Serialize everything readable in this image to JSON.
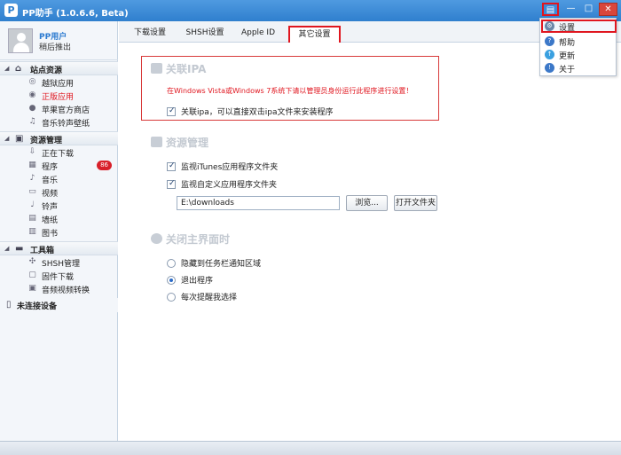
{
  "window": {
    "title": "PP助手 (1.0.6.6, Beta)",
    "logo_letter": "P"
  },
  "user": {
    "name": "PP用户",
    "status": "稍后推出"
  },
  "sidebar": {
    "groups": [
      {
        "label": "站点资源",
        "items": [
          "越狱应用",
          "正版应用",
          "苹果官方商店",
          "音乐铃声壁纸"
        ]
      },
      {
        "label": "资源管理",
        "items": [
          "正在下载",
          "程序",
          "音乐",
          "视频",
          "铃声",
          "墙纸",
          "图书"
        ],
        "badge": "86"
      },
      {
        "label": "工具箱",
        "items": [
          "SHSH管理",
          "固件下载",
          "音频视频转换"
        ]
      }
    ],
    "device": "未连接设备"
  },
  "tabs": [
    "下载设置",
    "SHSH设置",
    "Apple ID",
    "其它设置"
  ],
  "settings": {
    "ipa": {
      "title": "关联IPA",
      "warning": "在Windows Vista或Windows 7系统下请以管理员身份运行此程序进行设置！",
      "option": "关联ipa，可以直接双击ipa文件来安装程序"
    },
    "resource": {
      "title": "资源管理",
      "monitor_itunes": "监视iTunes应用程序文件夹",
      "monitor_custom": "监视自定义应用程序文件夹",
      "path": "E:\\downloads",
      "browse": "浏览...",
      "open_folder": "打开文件夹"
    },
    "close": {
      "title": "关闭主界面时",
      "options": [
        "隐藏到任务栏通知区域",
        "退出程序",
        "每次提醒我选择"
      ]
    }
  },
  "menu": {
    "items": [
      "设置",
      "帮助",
      "更新",
      "关于"
    ]
  },
  "colors": {
    "accent": "#2f7fce",
    "highlight": "#e0161f"
  }
}
